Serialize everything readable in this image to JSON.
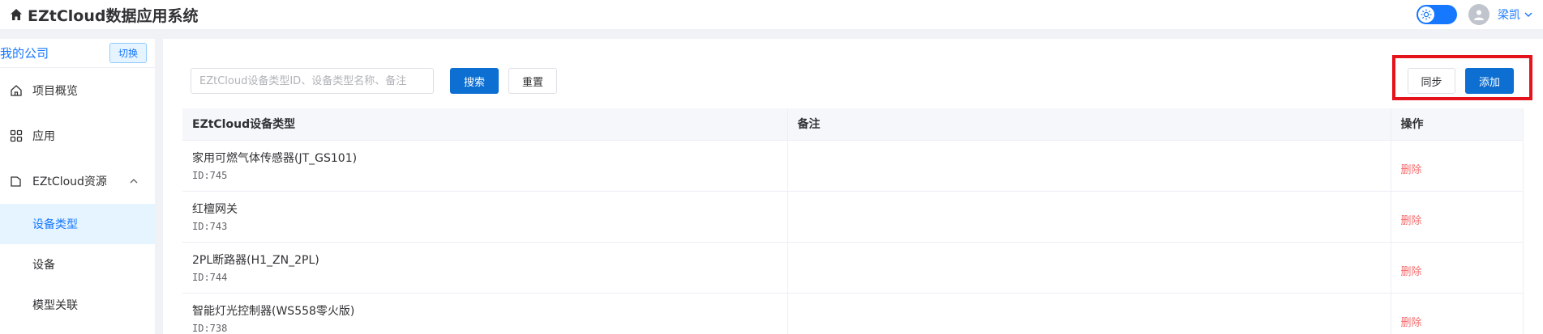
{
  "header": {
    "app_title": "EZtCloud数据应用系统",
    "user_name": "梁凯"
  },
  "sidebar": {
    "company": "我的公司",
    "switch_label": "切换",
    "items": [
      {
        "label": "项目概览",
        "icon": "home-icon"
      },
      {
        "label": "应用",
        "icon": "grid-icon"
      },
      {
        "label": "EZtCloud资源",
        "icon": "folder-icon"
      }
    ],
    "sub_items": [
      {
        "label": "设备类型",
        "active": true
      },
      {
        "label": "设备",
        "active": false
      },
      {
        "label": "模型关联",
        "active": false
      }
    ]
  },
  "toolbar": {
    "search_placeholder": "EZtCloud设备类型ID、设备类型名称、备注",
    "search_label": "搜索",
    "reset_label": "重置",
    "sync_label": "同步",
    "add_label": "添加"
  },
  "table": {
    "columns": [
      "EZtCloud设备类型",
      "备注",
      "操作"
    ],
    "rows": [
      {
        "name": "家用可燃气体传感器(JT_GS101)",
        "id": "ID:745",
        "note": "",
        "action": "删除"
      },
      {
        "name": "红檀网关",
        "id": "ID:743",
        "note": "",
        "action": "删除"
      },
      {
        "name": "2PL断路器(H1_ZN_2PL)",
        "id": "ID:744",
        "note": "",
        "action": "删除"
      },
      {
        "name": "智能灯光控制器(WS558零火版)",
        "id": "ID:738",
        "note": "",
        "action": "删除"
      }
    ]
  },
  "colors": {
    "primary": "#0d6fd1",
    "link": "#1677ff",
    "danger": "#f56c6c",
    "highlight": "#e5131c"
  }
}
